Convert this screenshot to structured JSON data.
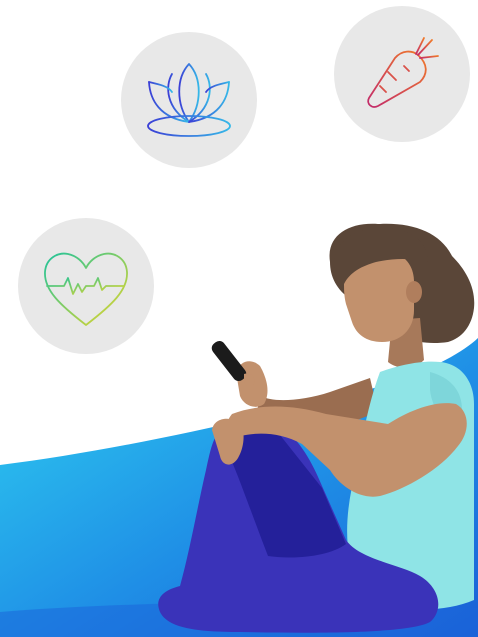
{
  "illustration": {
    "badges": [
      {
        "icon": "lotus-icon",
        "meaning": "wellness"
      },
      {
        "icon": "carrot-icon",
        "meaning": "nutrition"
      },
      {
        "icon": "heart-pulse-icon",
        "meaning": "heart health"
      }
    ],
    "person": "woman-with-phone",
    "colors": {
      "badge_bg": "#e8e8e8",
      "wave_light": "#2fd0f0",
      "wave_dark": "#1a63d8",
      "pants": "#3a33b9",
      "pants_dark": "#24209a",
      "shirt": "#8fe4e6",
      "skin": "#c2916d",
      "skin_dark": "#8f6349",
      "hair": "#5a4638",
      "phone": "#1b1b1b"
    }
  }
}
